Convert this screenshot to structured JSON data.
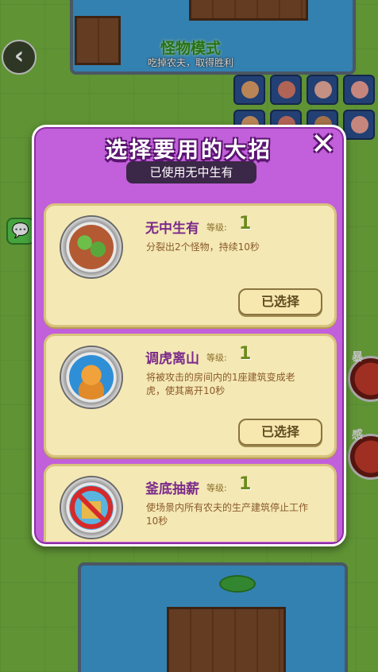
{
  "hud": {
    "mode_title": "怪物模式",
    "mode_subtitle": "吃掉农夫，取得胜利",
    "back_glyph": "‹",
    "chat_glyph": "💬",
    "side_glyphs": [
      "暴",
      "感"
    ]
  },
  "dialog": {
    "title": "选择要用的大招",
    "close_glyph": "✕",
    "used_notice": "已使用无中生有",
    "skills": [
      {
        "name": "无中生有",
        "level_label": "等级:",
        "level": "1",
        "description": "分裂出2个怪物，持续10秒",
        "button": "已选择",
        "icon": "monsters-clone-icon"
      },
      {
        "name": "调虎离山",
        "level_label": "等级:",
        "level": "1",
        "description": "将被攻击的房间内的1座建筑变成老虎，使其离开10秒",
        "button": "已选择",
        "icon": "tiger-icon"
      },
      {
        "name": "釜底抽薪",
        "level_label": "等级:",
        "level": "1",
        "description": "使场景内所有农夫的生产建筑停止工作10秒",
        "button": "",
        "icon": "no-production-icon"
      }
    ]
  },
  "colors": {
    "dialog_bg": "#c25fda",
    "card_bg": "#f4e8b4",
    "skill_name": "#7b2a8a",
    "level_value": "#6d8a1c"
  }
}
